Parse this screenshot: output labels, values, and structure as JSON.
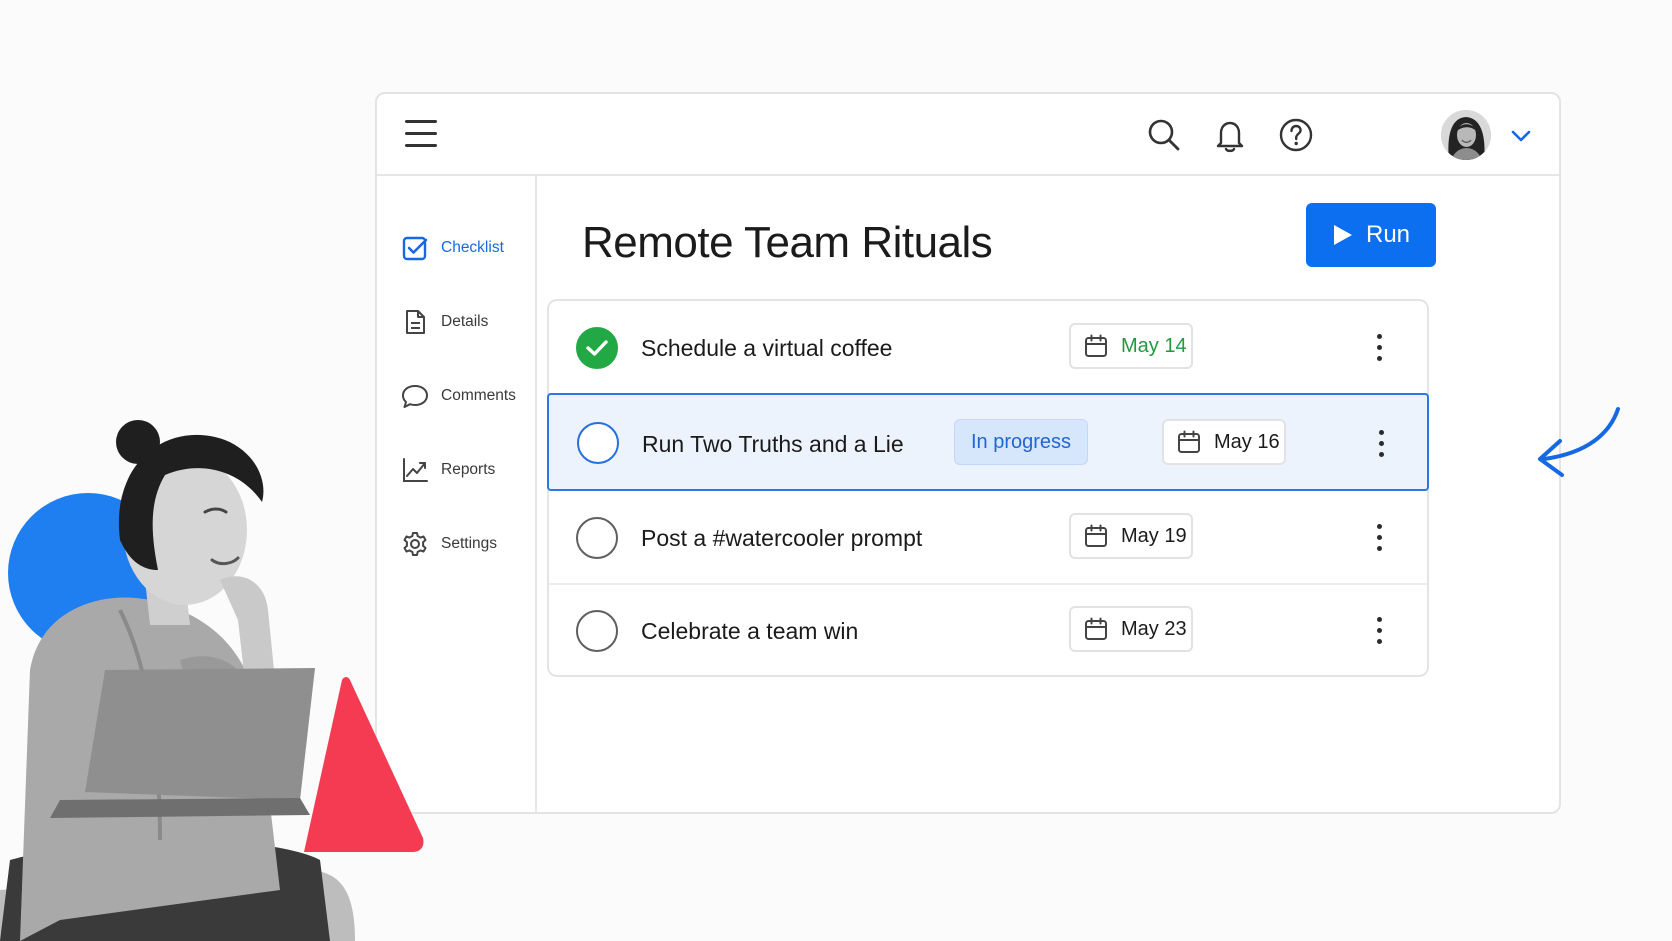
{
  "header": {
    "menu_icon": "hamburger-menu-icon",
    "search_icon": "search-icon",
    "notifications_icon": "bell-icon",
    "help_icon": "help-icon",
    "avatar_icon": "user-avatar",
    "account_menu_icon": "chevron-down-icon"
  },
  "sidebar": {
    "items": [
      {
        "label": "Checklist",
        "icon": "checkbox-icon",
        "active": true
      },
      {
        "label": "Details",
        "icon": "document-icon",
        "active": false
      },
      {
        "label": "Comments",
        "icon": "speech-bubble-icon",
        "active": false
      },
      {
        "label": "Reports",
        "icon": "line-chart-icon",
        "active": false
      },
      {
        "label": "Settings",
        "icon": "gear-icon",
        "active": false
      }
    ]
  },
  "main": {
    "title": "Remote Team Rituals",
    "run_label": "Run",
    "tasks": [
      {
        "label": "Schedule a virtual coffee",
        "status": "",
        "date": "May 14",
        "completed": true,
        "highlighted": false
      },
      {
        "label": "Run Two Truths and a Lie",
        "status": "In progress",
        "date": "May 16",
        "completed": false,
        "highlighted": true
      },
      {
        "label": "Post a #watercooler prompt",
        "status": "",
        "date": "May 19",
        "completed": false,
        "highlighted": false
      },
      {
        "label": "Celebrate a team win",
        "status": "",
        "date": "May 23",
        "completed": false,
        "highlighted": false
      }
    ]
  },
  "colors": {
    "accent_blue": "#0b6ff0",
    "done_green": "#22a845",
    "highlight_bg": "#ecf3fd",
    "deco_blue": "#1f7ef0",
    "deco_red": "#f43b52"
  }
}
